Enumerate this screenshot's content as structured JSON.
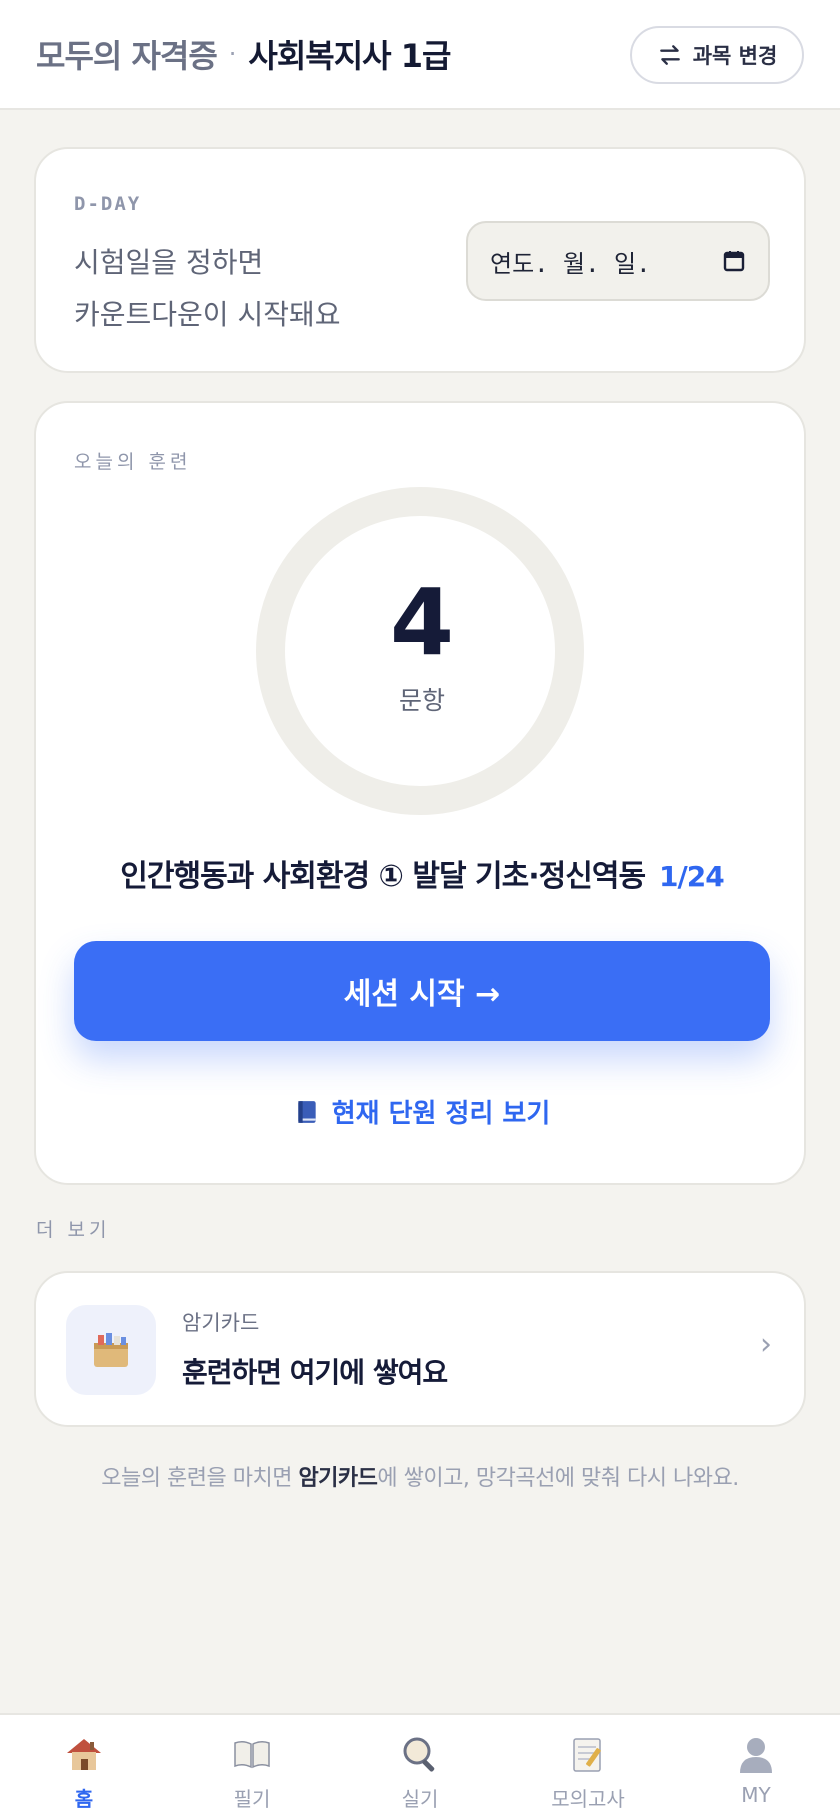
{
  "header": {
    "brand": "모두의 자격증",
    "separator": "·",
    "subject": "사회복지사 1급",
    "change_button": "과목 변경"
  },
  "dday": {
    "tag": "D-DAY",
    "line1": "시험일을 정하면",
    "line2": "카운트다운이 시작돼요",
    "date_placeholder": "연도. 월. 일."
  },
  "training": {
    "label": "오늘의 훈련",
    "count": "4",
    "unit": "문항",
    "topic": "인간행동과 사회환경 ① 발달 기초·정신역동",
    "progress": "1/24",
    "start_button": "세션 시작 →",
    "summary_link": "현재 단원 정리 보기"
  },
  "more": {
    "label": "더 보기"
  },
  "flashcard": {
    "title": "암기카드",
    "subtitle": "훈련하면 여기에 쌓여요",
    "chevron": "›"
  },
  "footer_note": {
    "before": "오늘의 훈련을 마치면 ",
    "bold": "암기카드",
    "after": "에 쌓이고, 망각곡선에 맞춰 다시 나와요."
  },
  "nav": {
    "items": [
      {
        "label": "홈",
        "icon": "home-icon",
        "active": true
      },
      {
        "label": "필기",
        "icon": "book-icon",
        "active": false
      },
      {
        "label": "실기",
        "icon": "magnifier-icon",
        "active": false
      },
      {
        "label": "모의고사",
        "icon": "memo-icon",
        "active": false
      },
      {
        "label": "MY",
        "icon": "profile-icon",
        "active": false
      }
    ]
  },
  "colors": {
    "accent": "#3a6ef5",
    "background": "#f4f3ef"
  }
}
